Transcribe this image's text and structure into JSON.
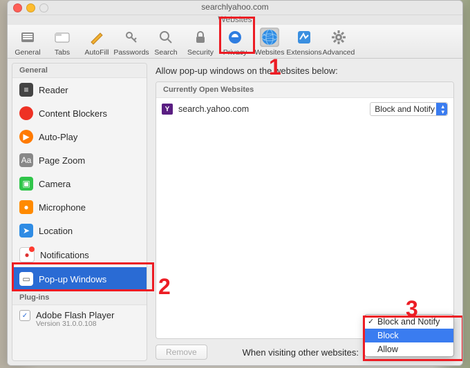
{
  "window": {
    "title": "Websites",
    "url_snippet": "searchlyahoo.com"
  },
  "toolbar": [
    {
      "id": "general",
      "label": "General"
    },
    {
      "id": "tabs",
      "label": "Tabs"
    },
    {
      "id": "autofill",
      "label": "AutoFill"
    },
    {
      "id": "passwords",
      "label": "Passwords"
    },
    {
      "id": "search",
      "label": "Search"
    },
    {
      "id": "security",
      "label": "Security"
    },
    {
      "id": "privacy",
      "label": "Privacy"
    },
    {
      "id": "websites",
      "label": "Websites",
      "active": true
    },
    {
      "id": "extensions",
      "label": "Extensions"
    },
    {
      "id": "advanced",
      "label": "Advanced"
    }
  ],
  "sidebar": {
    "sections": {
      "general": "General",
      "plugins": "Plug-ins"
    },
    "items": [
      {
        "id": "reader",
        "label": "Reader"
      },
      {
        "id": "content-blockers",
        "label": "Content Blockers"
      },
      {
        "id": "auto-play",
        "label": "Auto-Play"
      },
      {
        "id": "page-zoom",
        "label": "Page Zoom"
      },
      {
        "id": "camera",
        "label": "Camera"
      },
      {
        "id": "microphone",
        "label": "Microphone"
      },
      {
        "id": "location",
        "label": "Location"
      },
      {
        "id": "notifications",
        "label": "Notifications"
      },
      {
        "id": "popup-windows",
        "label": "Pop-up Windows",
        "selected": true
      }
    ],
    "plugins": [
      {
        "id": "flash",
        "label": "Adobe Flash Player",
        "version": "Version 31.0.0.108",
        "checked": true
      }
    ]
  },
  "main": {
    "heading": "Allow pop-up windows on the websites below:",
    "list_header": "Currently Open Websites",
    "rows": [
      {
        "site": "search.yahoo.com",
        "setting": "Block and Notify",
        "favicon_letter": "Y"
      }
    ],
    "remove_label": "Remove",
    "visiting_label": "When visiting other websites:",
    "visiting_options": [
      "Block and Notify",
      "Block",
      "Allow"
    ],
    "visiting_selected": "Block"
  },
  "annotations": {
    "n1": "1",
    "n2": "2",
    "n3": "3"
  }
}
